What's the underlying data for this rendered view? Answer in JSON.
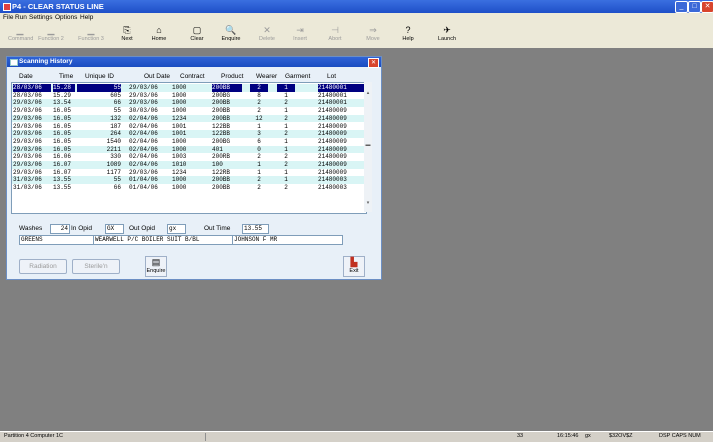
{
  "window": {
    "title": "P4 - CLEAR STATUS LINE",
    "minimize": "_",
    "maximize": "□",
    "close": "✕"
  },
  "menu": [
    "File",
    "Run",
    "Settings",
    "Options",
    "Help"
  ],
  "toolbar": [
    {
      "label": "Command",
      "icon": "▁",
      "enabled": false
    },
    {
      "label": "Function 2",
      "icon": "▁",
      "enabled": false
    },
    {
      "label": "Function 3",
      "icon": "▁",
      "enabled": false
    },
    {
      "label": "Next",
      "icon": "⎘",
      "enabled": true
    },
    {
      "label": "Home",
      "icon": "⌂",
      "enabled": true
    },
    {
      "label": "Clear",
      "icon": "▢",
      "enabled": true
    },
    {
      "label": "Enquire",
      "icon": "🔍",
      "enabled": true
    },
    {
      "label": "Delete",
      "icon": "✕",
      "enabled": false
    },
    {
      "label": "Insert",
      "icon": "⇥",
      "enabled": false
    },
    {
      "label": "Abort",
      "icon": "⊣",
      "enabled": false
    },
    {
      "label": "Move",
      "icon": "⇒",
      "enabled": false
    },
    {
      "label": "Help",
      "icon": "?",
      "enabled": true
    },
    {
      "label": "Launch",
      "icon": "✈",
      "enabled": true
    }
  ],
  "dialog": {
    "title": "Scanning History",
    "close": "✕",
    "columns": [
      "Date",
      "Time",
      "Unique ID",
      "Out Date",
      "Contract",
      "Product",
      "Wearer",
      "Garment",
      "Lot"
    ],
    "rows": [
      [
        "28/03/06",
        "15.28",
        "55",
        "29/03/06",
        "1000",
        "200BB",
        "2",
        "1",
        "21480001"
      ],
      [
        "28/03/06",
        "15.29",
        "605",
        "29/03/06",
        "1000",
        "200BG",
        "8",
        "1",
        "21480001"
      ],
      [
        "29/03/06",
        "13.54",
        "66",
        "29/03/06",
        "1000",
        "200BB",
        "2",
        "2",
        "21480001"
      ],
      [
        "29/03/06",
        "16.05",
        "55",
        "30/03/06",
        "1000",
        "200BB",
        "2",
        "1",
        "21480009"
      ],
      [
        "29/03/06",
        "16.05",
        "132",
        "02/04/06",
        "1234",
        "200BB",
        "12",
        "2",
        "21480009"
      ],
      [
        "29/03/06",
        "16.05",
        "187",
        "02/04/06",
        "1001",
        "122BB",
        "1",
        "1",
        "21480009"
      ],
      [
        "29/03/06",
        "16.05",
        "264",
        "02/04/06",
        "1001",
        "122BB",
        "3",
        "2",
        "21480009"
      ],
      [
        "29/03/06",
        "16.05",
        "1540",
        "02/04/06",
        "1000",
        "200BG",
        "6",
        "1",
        "21480009"
      ],
      [
        "29/03/06",
        "16.05",
        "2211",
        "02/04/06",
        "1000",
        "401",
        "0",
        "1",
        "21480009"
      ],
      [
        "29/03/06",
        "16.06",
        "330",
        "02/04/06",
        "1003",
        "200RB",
        "2",
        "2",
        "21480009"
      ],
      [
        "29/03/06",
        "16.07",
        "1089",
        "02/04/06",
        "1010",
        "100",
        "1",
        "2",
        "21480009"
      ],
      [
        "29/03/06",
        "16.07",
        "1177",
        "29/03/06",
        "1234",
        "122RB",
        "1",
        "1",
        "21480009"
      ],
      [
        "31/03/06",
        "13.55",
        "55",
        "01/04/06",
        "1000",
        "200BB",
        "2",
        "1",
        "21480003"
      ],
      [
        "31/03/06",
        "13.55",
        "66",
        "01/04/06",
        "1000",
        "200BB",
        "2",
        "2",
        "21480003"
      ]
    ],
    "fields": {
      "washes_label": "Washes",
      "washes": "24",
      "in_opid_label": "In Opid",
      "in_opid": "GX",
      "out_opid_label": "Out Opid",
      "out_opid": "gx",
      "out_time_label": "Out Time",
      "out_time": "13.55",
      "colour": "GREENS",
      "description": "WEARWELL P/C BOILER SUIT B/BL",
      "wearer_name": "JOHNSON F MR"
    },
    "buttons": {
      "radiation": "Radiation",
      "sterilisation": "Sterile'n",
      "enquire": "Enquire",
      "exit": "Exit"
    }
  },
  "status": {
    "partition": "Partition 4 Computer 1C",
    "num": "33",
    "time": "16:15:46",
    "op": "gx",
    "user": "$32OV$Z",
    "flags": "DSP  CAPS  NUM"
  }
}
